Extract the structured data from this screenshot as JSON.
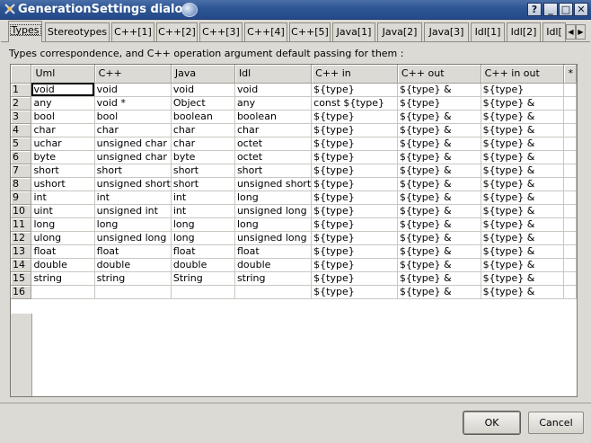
{
  "window": {
    "title": "GenerationSettings dialog",
    "buttons": {
      "help": "?",
      "minimize": "_",
      "maximize": "□",
      "close": "✕"
    }
  },
  "tabs": [
    {
      "label": "Types",
      "active": true
    },
    {
      "label": "Stereotypes"
    },
    {
      "label": "C++[1]"
    },
    {
      "label": "C++[2]"
    },
    {
      "label": "C++[3]"
    },
    {
      "label": "C++[4]"
    },
    {
      "label": "C++[5]"
    },
    {
      "label": "Java[1]"
    },
    {
      "label": "Java[2]"
    },
    {
      "label": "Java[3]"
    },
    {
      "label": "Idl[1]"
    },
    {
      "label": "Idl[2]"
    },
    {
      "label": "Idl["
    }
  ],
  "tab_scroll": {
    "left": "◀",
    "right": "▶"
  },
  "caption": "Types correspondence, and C++ operation argument default passing for them :",
  "table": {
    "headers": [
      "Uml",
      "C++",
      "Java",
      "Idl",
      "C++ in",
      "C++ out",
      "C++ in out",
      "*"
    ],
    "rows": [
      {
        "n": "1",
        "cells": [
          "void",
          "void",
          "void",
          "void",
          "${type}",
          "${type} &",
          "${type}",
          ""
        ]
      },
      {
        "n": "2",
        "cells": [
          "any",
          "void *",
          "Object",
          "any",
          "const ${type}",
          "${type}",
          "${type} &",
          ""
        ]
      },
      {
        "n": "3",
        "cells": [
          "bool",
          "bool",
          "boolean",
          "boolean",
          "${type}",
          "${type} &",
          "${type} &",
          ""
        ]
      },
      {
        "n": "4",
        "cells": [
          "char",
          "char",
          "char",
          "char",
          "${type}",
          "${type} &",
          "${type} &",
          ""
        ]
      },
      {
        "n": "5",
        "cells": [
          "uchar",
          "unsigned char",
          "char",
          "octet",
          "${type}",
          "${type} &",
          "${type} &",
          ""
        ]
      },
      {
        "n": "6",
        "cells": [
          "byte",
          "unsigned char",
          "byte",
          "octet",
          "${type}",
          "${type} &",
          "${type} &",
          ""
        ]
      },
      {
        "n": "7",
        "cells": [
          "short",
          "short",
          "short",
          "short",
          "${type}",
          "${type} &",
          "${type} &",
          ""
        ]
      },
      {
        "n": "8",
        "cells": [
          "ushort",
          "unsigned short",
          "short",
          "unsigned short",
          "${type}",
          "${type} &",
          "${type} &",
          ""
        ]
      },
      {
        "n": "9",
        "cells": [
          "int",
          "int",
          "int",
          "long",
          "${type}",
          "${type} &",
          "${type} &",
          ""
        ]
      },
      {
        "n": "10",
        "cells": [
          "uint",
          "unsigned int",
          "int",
          "unsigned long",
          "${type}",
          "${type} &",
          "${type} &",
          ""
        ]
      },
      {
        "n": "11",
        "cells": [
          "long",
          "long",
          "long",
          "long",
          "${type}",
          "${type} &",
          "${type} &",
          ""
        ]
      },
      {
        "n": "12",
        "cells": [
          "ulong",
          "unsigned long",
          "long",
          "unsigned long",
          "${type}",
          "${type} &",
          "${type} &",
          ""
        ]
      },
      {
        "n": "13",
        "cells": [
          "float",
          "float",
          "float",
          "float",
          "${type}",
          "${type} &",
          "${type} &",
          ""
        ]
      },
      {
        "n": "14",
        "cells": [
          "double",
          "double",
          "double",
          "double",
          "${type}",
          "${type} &",
          "${type} &",
          ""
        ]
      },
      {
        "n": "15",
        "cells": [
          "string",
          "string",
          "String",
          "string",
          "${type}",
          "${type} &",
          "${type} &",
          ""
        ]
      },
      {
        "n": "16",
        "cells": [
          "",
          "",
          "",
          "",
          "${type}",
          "${type} &",
          "${type} &",
          ""
        ]
      }
    ]
  },
  "footer": {
    "ok": "OK",
    "cancel": "Cancel"
  },
  "colors": {
    "titlebar": "#2d5593",
    "background": "#dcdad5"
  }
}
